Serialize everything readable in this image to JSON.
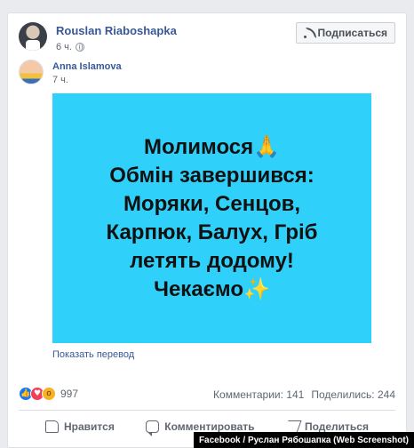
{
  "post": {
    "author": "Rouslan Riaboshapka",
    "time": "6 ч.",
    "subscribe_label": "Подписаться"
  },
  "shared": {
    "author": "Anna Islamova",
    "time": "7 ч."
  },
  "image_text": {
    "line1": "Молимося🙏",
    "line2": "Обмін завершився:",
    "line3": "Моряки, Сенцов,",
    "line4": "Карпюк, Балух, Гріб",
    "line5": "летять додому!",
    "line6": "Чекаємо✨",
    "background": "#2fd1fa"
  },
  "translate_link": "Показать перевод",
  "stats": {
    "reactions_count": "997",
    "comments": "Комментарии: 141",
    "shares": "Поделились: 244"
  },
  "actions": {
    "like": "Нравится",
    "comment": "Комментировать",
    "share": "Поделиться"
  },
  "watermark": "Facebook / Руслан Рябошапка (Web Screenshot)",
  "colors": {
    "link": "#385898",
    "accent_like": "#1877f2"
  }
}
